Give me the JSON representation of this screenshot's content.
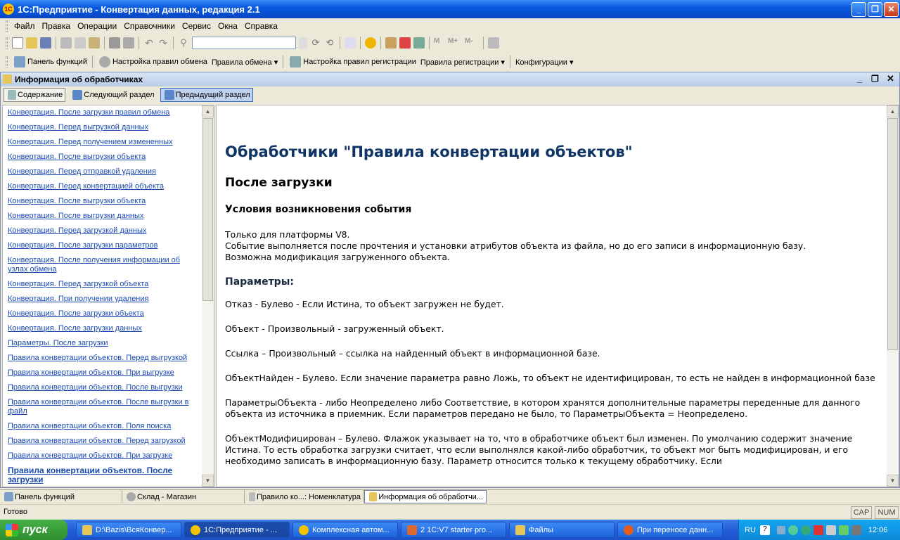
{
  "window": {
    "title": "1С:Предприятие - Конвертация данных, редакция 2.1",
    "logo": "1C"
  },
  "menu": [
    "Файл",
    "Правка",
    "Операции",
    "Справочники",
    "Сервис",
    "Окна",
    "Справка"
  ],
  "toolbar2": [
    {
      "label": "Панель функций",
      "icon": "panel-icon"
    },
    {
      "label": "Настройка правил обмена",
      "icon": "gear-icon"
    },
    {
      "label": "Правила обмена ▾",
      "icon": ""
    },
    {
      "label": "Настройка правил регистрации",
      "icon": "register-icon"
    },
    {
      "label": "Правила регистрации ▾",
      "icon": ""
    },
    {
      "label": "Конфигурации ▾",
      "icon": ""
    }
  ],
  "inner": {
    "title": "Информация об обработчиках",
    "nav": {
      "contents": "Содержание",
      "next": "Следующий раздел",
      "prev": "Предыдущий раздел"
    }
  },
  "links": [
    "Конвертация. После загрузки правил обмена",
    "Конвертация. Перед выгрузкой данных",
    "Конвертация. Перед получением измененных",
    "Конвертация. После выгрузки объекта",
    "Конвертация. Перед отправкой удаления",
    "Конвертация. Перед конвертацией объекта",
    "Конвертация. После выгрузки объекта",
    "Конвертация. После выгрузки данных",
    "Конвертация. Перед загрузкой данных",
    "Конвертация. После загрузки параметров",
    "Конвертация. После получения информации об узлах обмена",
    "Конвертация. Перед загрузкой объекта",
    "Конвертация. При получении удаления",
    "Конвертация. После загрузки объекта",
    "Конвертация. После загрузки данных",
    "Параметры. После загрузки",
    "Правила конвертации объектов. Перед выгрузкой",
    "Правила конвертации объектов. При выгрузке",
    "Правила конвертации объектов. После выгрузки",
    "Правила конвертации объектов. После выгрузки в файл",
    "Правила конвертации объектов. Поля поиска",
    "Правила конвертации объектов. Перед загрузкой",
    "Правила конвертации объектов. При загрузке",
    "Правила конвертации объектов. После загрузки"
  ],
  "doc": {
    "h1": "Обработчики \"Правила конвертации объектов\"",
    "h2": "После загрузки",
    "h3": "Условия возникновения события",
    "cond": [
      "Только для платформы V8.",
      "Событие выполняется после прочтения и установки атрибутов объекта из файла, но до его записи в информационную базу.",
      "Возможна модификация загруженного объекта."
    ],
    "params_title": "Параметры:",
    "params": [
      "Отказ - Булево - Если Истина, то объект загружен не будет.",
      "Объект - Произвольный - загруженный объект.",
      "Ссылка – Произвольный – ссылка на найденный объект в информационной базе.",
      "ОбъектНайден - Булево. Если значение параметра равно Ложь, то объект не идентифицирован, то есть не найден в информационной базе",
      "ПараметрыОбъекта - либо Неопределено либо Соответствие, в котором хранятся дополнительные параметры переденные для данного объекта из источника в приемник. Если параметров передано не было, то ПараметрыОбъекта = Неопределено.",
      "ОбъектМодифицирован – Булево. Флажок указывает на то, что в обработчике объект был изменен. По умолчанию содержит значение Истина. То есть обработка загрузки считает, что если выполнялся какой-либо обработчик, то объект мог быть модифицирован, и его необходимо записать в информационную базу. Параметр относится только к текущему обработчику. Если"
    ]
  },
  "wintabs": [
    "Панель функций",
    "Склад - Магазин",
    "Правило ко...: Номенклатура",
    "Информация об обработчи..."
  ],
  "status": {
    "text": "Готово",
    "cap": "CAP",
    "num": "NUM"
  },
  "taskbar": {
    "start": "пуск",
    "tasks": [
      "D:\\Bazis\\ВсяКонвер...",
      "1С:Предприятие - ...",
      "Комплексная автом...",
      "2 1C:V7 starter pro...",
      "Файлы",
      "При переносе данн..."
    ],
    "lang": "RU",
    "clock": "12:06"
  }
}
